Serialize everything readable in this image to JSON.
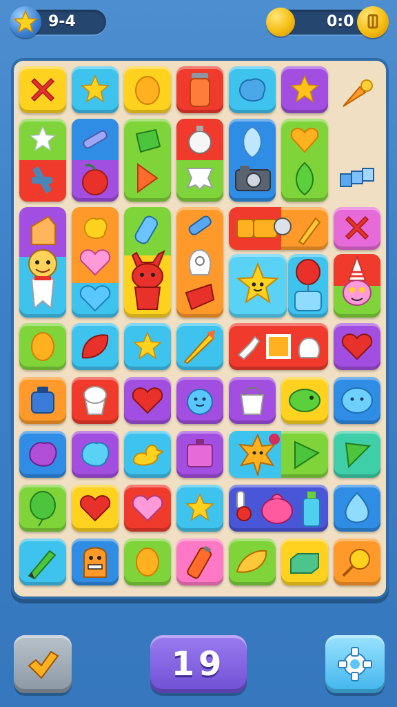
{
  "hud": {
    "left_counter": "9-4",
    "right_counter": "0:0",
    "left_icon": "star-icon",
    "right_coin_icon": "coin-icon",
    "right_button_icon": "settings-icon"
  },
  "controls": {
    "moves": "19",
    "back_icon": "back-arrow-icon",
    "settings_icon": "gear-icon"
  },
  "colors": {
    "background": "#3b80c6",
    "board": "#f0dfc2",
    "board_border": "#2f6aa9",
    "tile_yellow": "#ffd21f",
    "tile_cyan": "#3ec3ee",
    "tile_red": "#ef3a2c",
    "tile_green": "#7fd43a",
    "tile_purple": "#a24ee0",
    "tile_orange": "#ff9a2a",
    "tile_blue": "#2f8de5",
    "tile_pink": "#ff78c5",
    "moves_button": "#7a5ae0"
  },
  "board": {
    "tiles": [
      {
        "name": "tile-red-cross",
        "icon": "cross-icon"
      },
      {
        "name": "tile-star",
        "icon": "star-icon"
      },
      {
        "name": "tile-orange-egg",
        "icon": "egg-icon"
      },
      {
        "name": "tile-jar",
        "icon": "jar-icon"
      },
      {
        "name": "tile-blue-blob",
        "icon": "blob-icon"
      },
      {
        "name": "tile-gold-star",
        "icon": "star-icon"
      },
      {
        "name": "tile-carrot",
        "icon": "carrot-icon"
      },
      {
        "name": "tile-star-plug",
        "icon": "star-icon"
      },
      {
        "name": "tile-crayon-cherry",
        "icon": "crayon-icon"
      },
      {
        "name": "tile-green-gem",
        "icon": "gem-icon"
      },
      {
        "name": "tile-clock-bone",
        "icon": "clock-icon"
      },
      {
        "name": "tile-leaf-camera",
        "icon": "camera-icon"
      },
      {
        "name": "tile-heart-leaf",
        "icon": "heart-icon"
      },
      {
        "name": "tile-blocks",
        "icon": "blocks-icon"
      },
      {
        "name": "tile-character",
        "icon": "character-icon"
      },
      {
        "name": "tile-cake-heart",
        "icon": "heart-icon"
      },
      {
        "name": "tile-cat",
        "icon": "cat-icon"
      },
      {
        "name": "tile-crayon-ghost",
        "icon": "ghost-icon"
      },
      {
        "name": "tile-tools",
        "icon": "tools-icon"
      },
      {
        "name": "tile-cross-pink",
        "icon": "cross-icon"
      },
      {
        "name": "tile-star-face",
        "icon": "star-face-icon"
      },
      {
        "name": "tile-balloon",
        "icon": "balloon-icon"
      },
      {
        "name": "tile-gnome",
        "icon": "gnome-icon"
      },
      {
        "name": "tile-egg-green",
        "icon": "egg-icon"
      },
      {
        "name": "tile-red-leaf",
        "icon": "leaf-icon"
      },
      {
        "name": "tile-star-cyan",
        "icon": "star-icon"
      },
      {
        "name": "tile-rocket",
        "icon": "rocket-icon"
      },
      {
        "name": "tile-mixed-red",
        "icon": "square-icon"
      },
      {
        "name": "tile-heart-purple",
        "icon": "heart-icon"
      },
      {
        "name": "tile-pot",
        "icon": "pot-icon"
      },
      {
        "name": "tile-cupcake",
        "icon": "cupcake-icon"
      },
      {
        "name": "tile-heart-red",
        "icon": "heart-icon"
      },
      {
        "name": "tile-blue-face",
        "icon": "face-icon"
      },
      {
        "name": "tile-bucket",
        "icon": "bucket-icon"
      },
      {
        "name": "tile-green-fish",
        "icon": "fish-icon"
      },
      {
        "name": "tile-blue-fish",
        "icon": "fish-icon"
      },
      {
        "name": "tile-purple-blob",
        "icon": "blob-icon"
      },
      {
        "name": "tile-cyan-blob",
        "icon": "blob-icon"
      },
      {
        "name": "tile-duck",
        "icon": "duck-icon"
      },
      {
        "name": "tile-box",
        "icon": "box-icon"
      },
      {
        "name": "tile-sun-triangle",
        "icon": "sun-icon"
      },
      {
        "name": "tile-green-triangle",
        "icon": "triangle-icon"
      },
      {
        "name": "tile-balloon-green",
        "icon": "balloon-icon"
      },
      {
        "name": "tile-heart-yellow",
        "icon": "heart-icon"
      },
      {
        "name": "tile-heart-pink",
        "icon": "heart-icon"
      },
      {
        "name": "tile-star-blue",
        "icon": "star-icon"
      },
      {
        "name": "tile-toys",
        "icon": "toys-icon"
      },
      {
        "name": "tile-drop",
        "icon": "drop-icon"
      },
      {
        "name": "tile-pencil",
        "icon": "pencil-icon"
      },
      {
        "name": "tile-monster",
        "icon": "monster-icon"
      },
      {
        "name": "tile-egg-yellow",
        "icon": "egg-icon"
      },
      {
        "name": "tile-battery",
        "icon": "battery-icon"
      },
      {
        "name": "tile-cheese",
        "icon": "cheese-icon"
      },
      {
        "name": "tile-green-brick",
        "icon": "brick-icon"
      },
      {
        "name": "tile-lollipop",
        "icon": "lollipop-icon"
      }
    ]
  }
}
